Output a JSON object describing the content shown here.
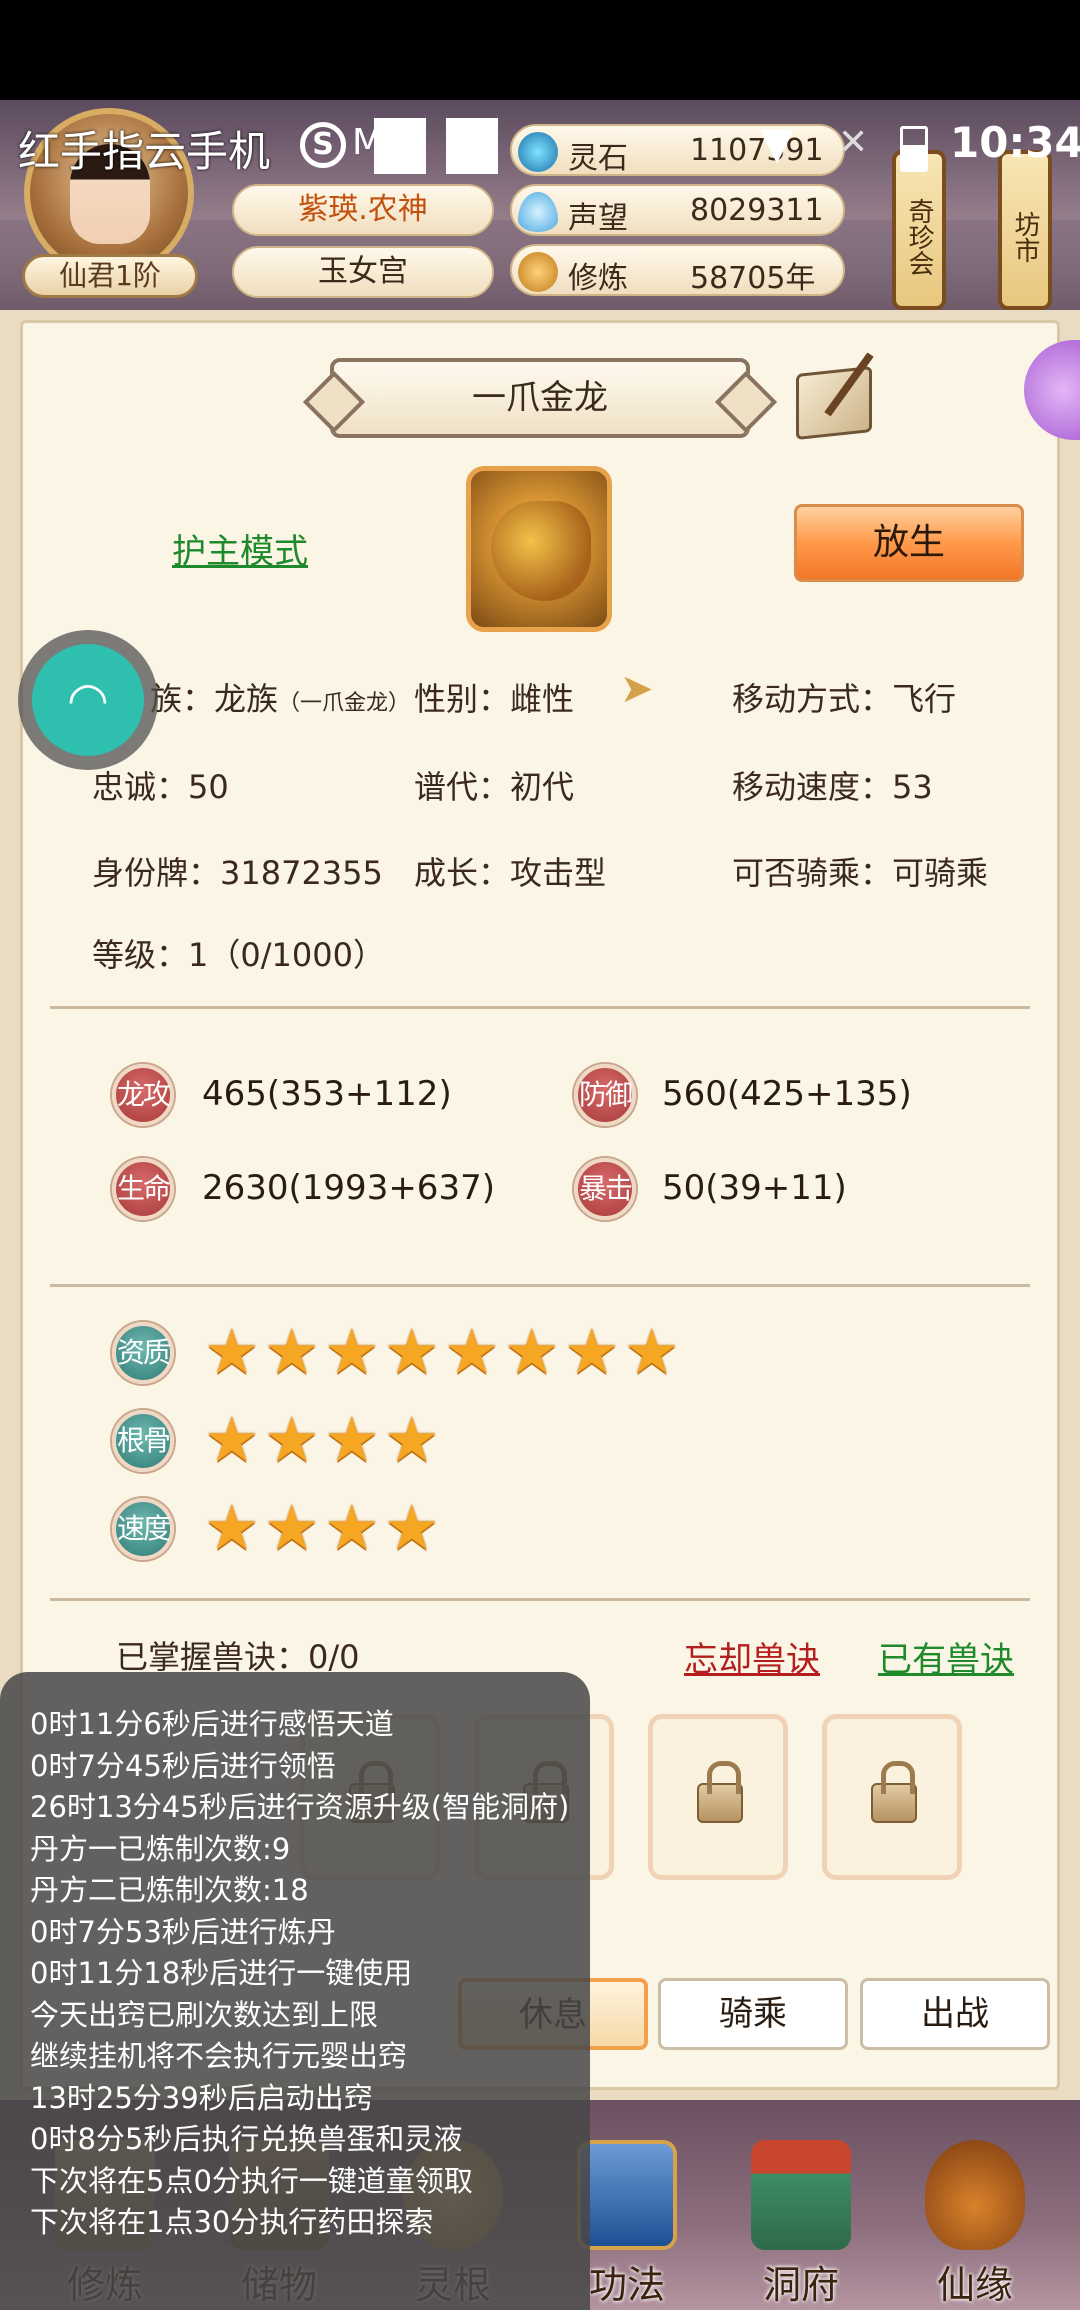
{
  "status_bar": {
    "app_name": "红手指云手机",
    "s_icon": "S",
    "m_text": "M",
    "time": "10:34",
    "icons": [
      "wifi-icon",
      "close-icon",
      "battery-icon"
    ]
  },
  "header": {
    "rank": "仙君1阶",
    "title": "紫瑛.农神",
    "sect": "玉女宫",
    "resources": [
      {
        "label": "灵石",
        "value": "1107591",
        "icon": "spirit-stone-icon"
      },
      {
        "label": "声望",
        "value": "8029311",
        "icon": "reputation-icon"
      },
      {
        "label": "修炼",
        "value": "58705年",
        "icon": "cultivation-icon"
      }
    ],
    "signs": [
      "奇珍会",
      "坊市"
    ]
  },
  "pet": {
    "name": "一爪金龙",
    "guard_mode": "护主模式",
    "release": "放生",
    "info": {
      "race_label": "族：",
      "race_value": "龙族",
      "race_sub": "（一爪金龙）",
      "gender": "性别：雌性",
      "move_type": "移动方式：飞行",
      "loyalty": "忠诚：50",
      "generation": "谱代：初代",
      "move_speed": "移动速度：53",
      "id_tag": "身份牌：31872355",
      "growth": "成长：攻击型",
      "rideable": "可否骑乘：可骑乘",
      "level": "等级：1（0/1000）"
    },
    "stats": [
      {
        "badge": "龙攻",
        "value": "465(353+112)"
      },
      {
        "badge": "防御",
        "value": "560(425+135)"
      },
      {
        "badge": "生命",
        "value": "2630(1993+637)"
      },
      {
        "badge": "暴击",
        "value": "50(39+11)"
      }
    ],
    "qualities": [
      {
        "badge": "资质",
        "stars": 8
      },
      {
        "badge": "根骨",
        "stars": 4
      },
      {
        "badge": "速度",
        "stars": 4
      }
    ],
    "skills": {
      "mastered": "已掌握兽诀：0/0",
      "forget": "忘却兽诀",
      "owned": "已有兽诀"
    },
    "tabs": [
      "休息",
      "骑乘",
      "出战"
    ],
    "active_tab": "休息"
  },
  "bottom_nav": [
    "修炼",
    "储物",
    "灵根",
    "功法",
    "洞府",
    "仙缘"
  ],
  "log": [
    "0时11分6秒后进行感悟天道",
    "0时7分45秒后进行领悟",
    "26时13分45秒后进行资源升级(智能洞府)",
    "丹方一已炼制次数:9",
    "丹方二已炼制次数:18",
    "0时7分53秒后进行炼丹",
    "0时11分18秒后进行一键使用",
    "今天出窍已刷次数达到上限",
    "继续挂机将不会执行元婴出窍",
    "13时25分39秒后启动出窍",
    "0时8分5秒后执行兑换兽蛋和灵液",
    "下次将在5点0分执行一键道童领取",
    "下次将在1点30分执行药田探索"
  ],
  "colors": {
    "guard_green": "#1f8a2b",
    "forget_red": "#b51e1e",
    "release_orange": "#f27628",
    "star": "#f5a623"
  }
}
